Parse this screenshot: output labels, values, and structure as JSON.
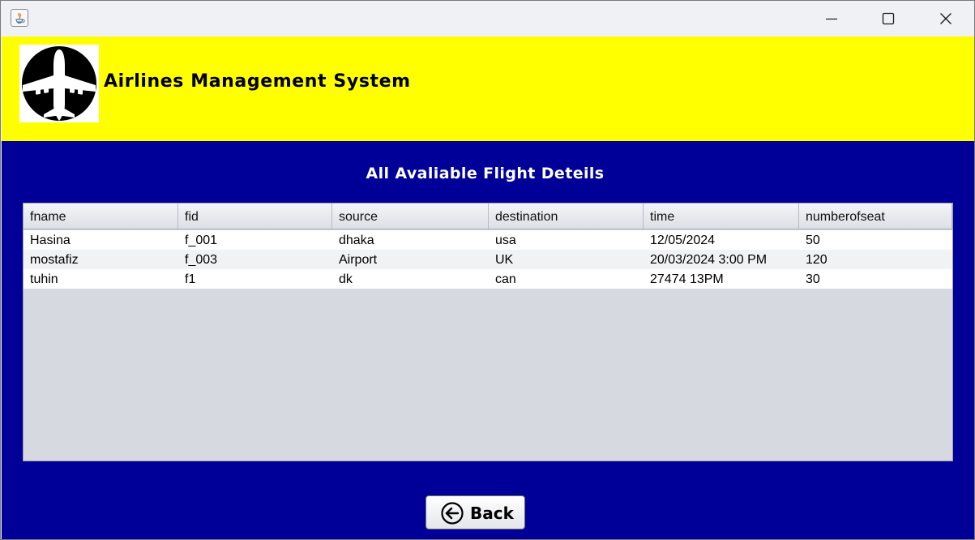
{
  "window": {
    "minimize_icon": "minimize-icon",
    "maximize_icon": "maximize-icon",
    "close_icon": "close-icon"
  },
  "header": {
    "title": "Airlines Management System",
    "background": "#ffff00",
    "logo_icon": "airplane-icon"
  },
  "main": {
    "background": "#000099",
    "section_title": "All Avaliable Flight Deteils"
  },
  "table": {
    "columns": [
      "fname",
      "fid",
      "source",
      "destination",
      "time",
      "numberofseat"
    ],
    "rows": [
      [
        "Hasina",
        "f_001",
        "dhaka",
        "usa",
        "12/05/2024",
        "50"
      ],
      [
        "mostafiz",
        "f_003",
        "Airport",
        "UK",
        "20/03/2024 3:00 PM",
        "120"
      ],
      [
        "tuhin",
        "f1",
        "dk",
        "can",
        "27474 13PM",
        "30"
      ]
    ]
  },
  "back_button": {
    "label": "Back",
    "icon": "arrow-left-circle-icon"
  }
}
